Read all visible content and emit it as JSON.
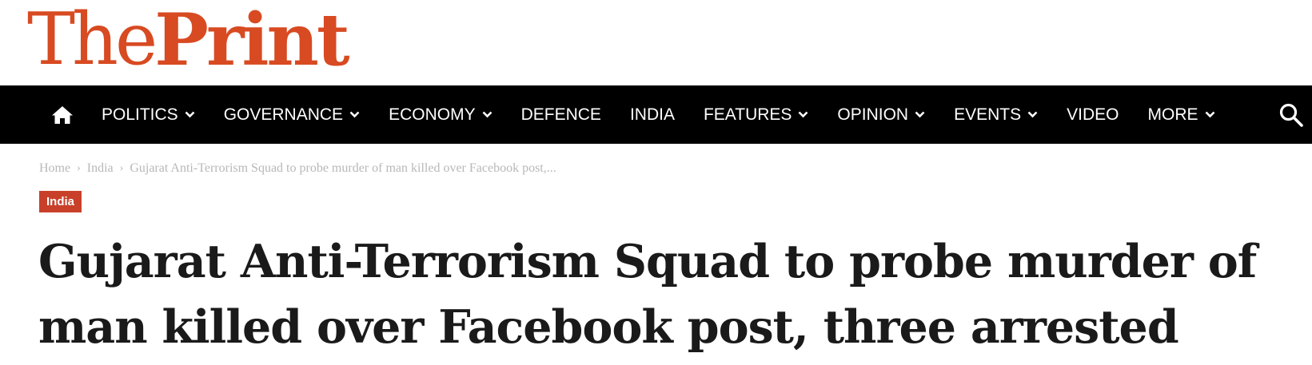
{
  "brand": {
    "logo_part1": "The",
    "logo_part2": "Print",
    "accent": "#d84a22"
  },
  "nav": {
    "home_icon": "home-icon",
    "search_icon": "search-icon",
    "items": [
      {
        "label": "POLITICS",
        "has_dropdown": true
      },
      {
        "label": "GOVERNANCE",
        "has_dropdown": true
      },
      {
        "label": "ECONOMY",
        "has_dropdown": true
      },
      {
        "label": "DEFENCE",
        "has_dropdown": false
      },
      {
        "label": "INDIA",
        "has_dropdown": false
      },
      {
        "label": "FEATURES",
        "has_dropdown": true
      },
      {
        "label": "OPINION",
        "has_dropdown": true
      },
      {
        "label": "EVENTS",
        "has_dropdown": true
      },
      {
        "label": "VIDEO",
        "has_dropdown": false
      },
      {
        "label": "MORE",
        "has_dropdown": true
      }
    ]
  },
  "breadcrumb": {
    "home": "Home",
    "section": "India",
    "current": "Gujarat Anti-Terrorism Squad to probe murder of man killed over Facebook post,..."
  },
  "article": {
    "category": "India",
    "category_color": "#c8402a",
    "headline": "Gujarat Anti-Terrorism Squad to probe murder of man killed over Facebook post, three arrested"
  }
}
